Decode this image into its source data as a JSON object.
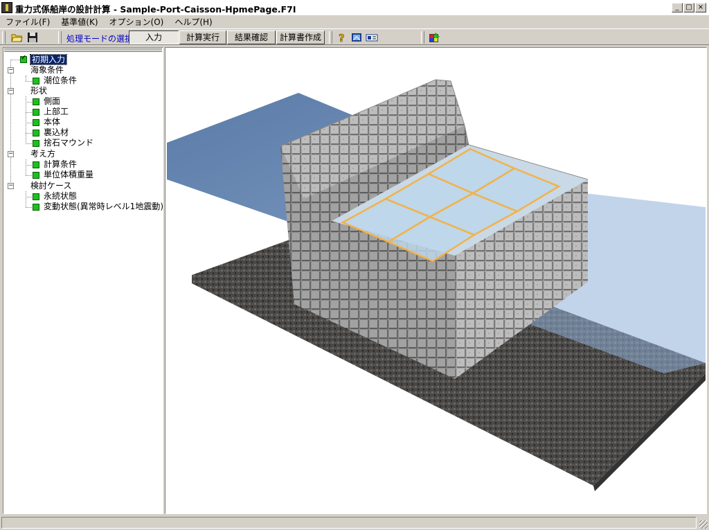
{
  "window": {
    "title": "重力式係船岸の設計計算 - Sample-Port-Caisson-HpmePage.F7I",
    "buttons": {
      "minimize": "_",
      "maximize": "□",
      "close": "×"
    }
  },
  "menu": [
    "ファイル(F)",
    "基準値(K)",
    "オプション(O)",
    "ヘルプ(H)"
  ],
  "toolbar": {
    "mode_label": "処理モードの選択",
    "modes": [
      "入力",
      "計算実行",
      "結果確認",
      "計算書作成"
    ],
    "active_mode": "入力",
    "icons": [
      "open-folder-icon",
      "save-disk-icon",
      "help-icon",
      "book-icon",
      "card-icon",
      "palette-icon"
    ]
  },
  "tree": {
    "root": "初期入力",
    "groups": [
      {
        "label": "海象条件",
        "items": [
          "潮位条件"
        ]
      },
      {
        "label": "形状",
        "items": [
          "側面",
          "上部工",
          "本体",
          "裏込材",
          "捨石マウンド"
        ]
      },
      {
        "label": "考え方",
        "items": [
          "計算条件",
          "単位体積重量"
        ]
      },
      {
        "label": "検討ケース",
        "items": [
          "永続状態",
          "変動状態(異常時レベル1地震動)"
        ]
      }
    ]
  },
  "colors": {
    "water": "#6e8fb8",
    "ground": "#4a4846",
    "caisson": "#a8a8a8",
    "cell_water": "#bcd6ea",
    "cell_rim": "#f2b24a",
    "selection": "#0a246a"
  }
}
